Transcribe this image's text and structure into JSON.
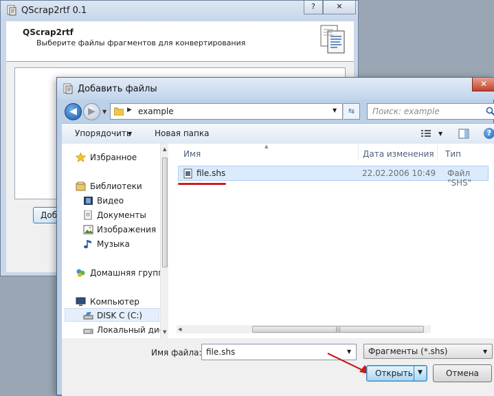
{
  "background_window": {
    "title": "QScrap2rtf 0.1",
    "header_title": "QScrap2rtf",
    "header_subtitle": "Выберите файлы фрагментов для конвертирования",
    "add_button_label": "Добавить",
    "caption_buttons": {
      "help": "?",
      "close": "✕"
    }
  },
  "dialog": {
    "title": "Добавить файлы",
    "close_glyph": "✕",
    "address": {
      "path": "example"
    },
    "search": {
      "placeholder": "Поиск: example"
    },
    "toolbar": {
      "organize_label": "Упорядочить",
      "new_folder_label": "Новая папка"
    },
    "nav": {
      "favorites": "Избранное",
      "libraries": "Библиотеки",
      "video": "Видео",
      "documents": "Документы",
      "images": "Изображения",
      "music": "Музыка",
      "homegroup": "Домашняя группа",
      "computer": "Компьютер",
      "disk_c": "DISK C (C:)",
      "local_disk": "Локальный диск"
    },
    "columns": {
      "name": "Имя",
      "date": "Дата изменения",
      "type": "Тип"
    },
    "files": [
      {
        "name": "file.shs",
        "date": "22.02.2006 10:49",
        "type": "Файл \"SHS\""
      }
    ],
    "filename_label": "Имя файла:",
    "filename_value": "file.shs",
    "filter_value": "Фрагменты (*.shs)",
    "open_button_label": "Открыть",
    "cancel_button_label": "Отмена"
  },
  "colors": {
    "annotation_red": "#d11a1a",
    "selection_blue": "#dcebfc"
  }
}
